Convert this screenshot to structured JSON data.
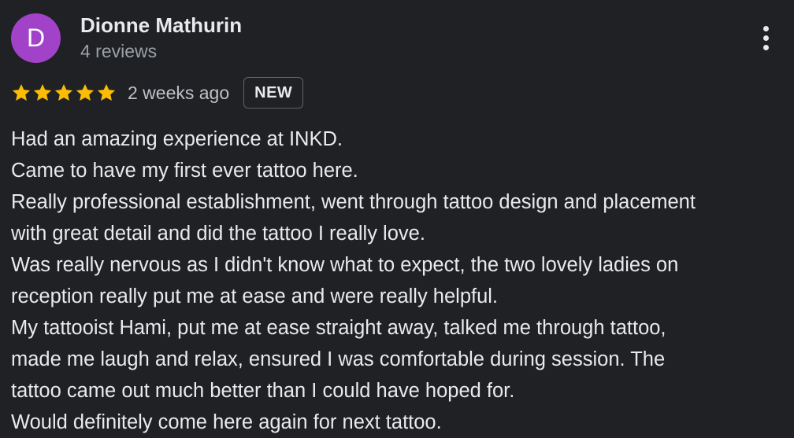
{
  "reviewer": {
    "avatar_letter": "D",
    "avatar_color": "#a142c9",
    "name": "Dionne Mathurin",
    "review_count": "4 reviews"
  },
  "rating": {
    "stars": 5,
    "max_stars": 5,
    "star_color": "#fbbc04",
    "date": "2 weeks ago",
    "badge": "NEW"
  },
  "menu": {
    "icon": "more-vert-icon"
  },
  "review": {
    "lines": [
      "Had an amazing experience at INKD.",
      "Came to have my first ever tattoo here.",
      "Really professional establishment, went through tattoo design and placement",
      "with great detail and did the tattoo I really love.",
      "Was really nervous as I didn't know what to expect, the two lovely ladies on",
      "reception really put me at ease and were really helpful.",
      "My tattooist Hami, put me at ease straight away, talked me through tattoo,",
      "made me laugh and relax, ensured I was comfortable during session. The",
      "tattoo came out much better than I could have hoped for.",
      "Would definitely come here again for next tattoo."
    ]
  }
}
